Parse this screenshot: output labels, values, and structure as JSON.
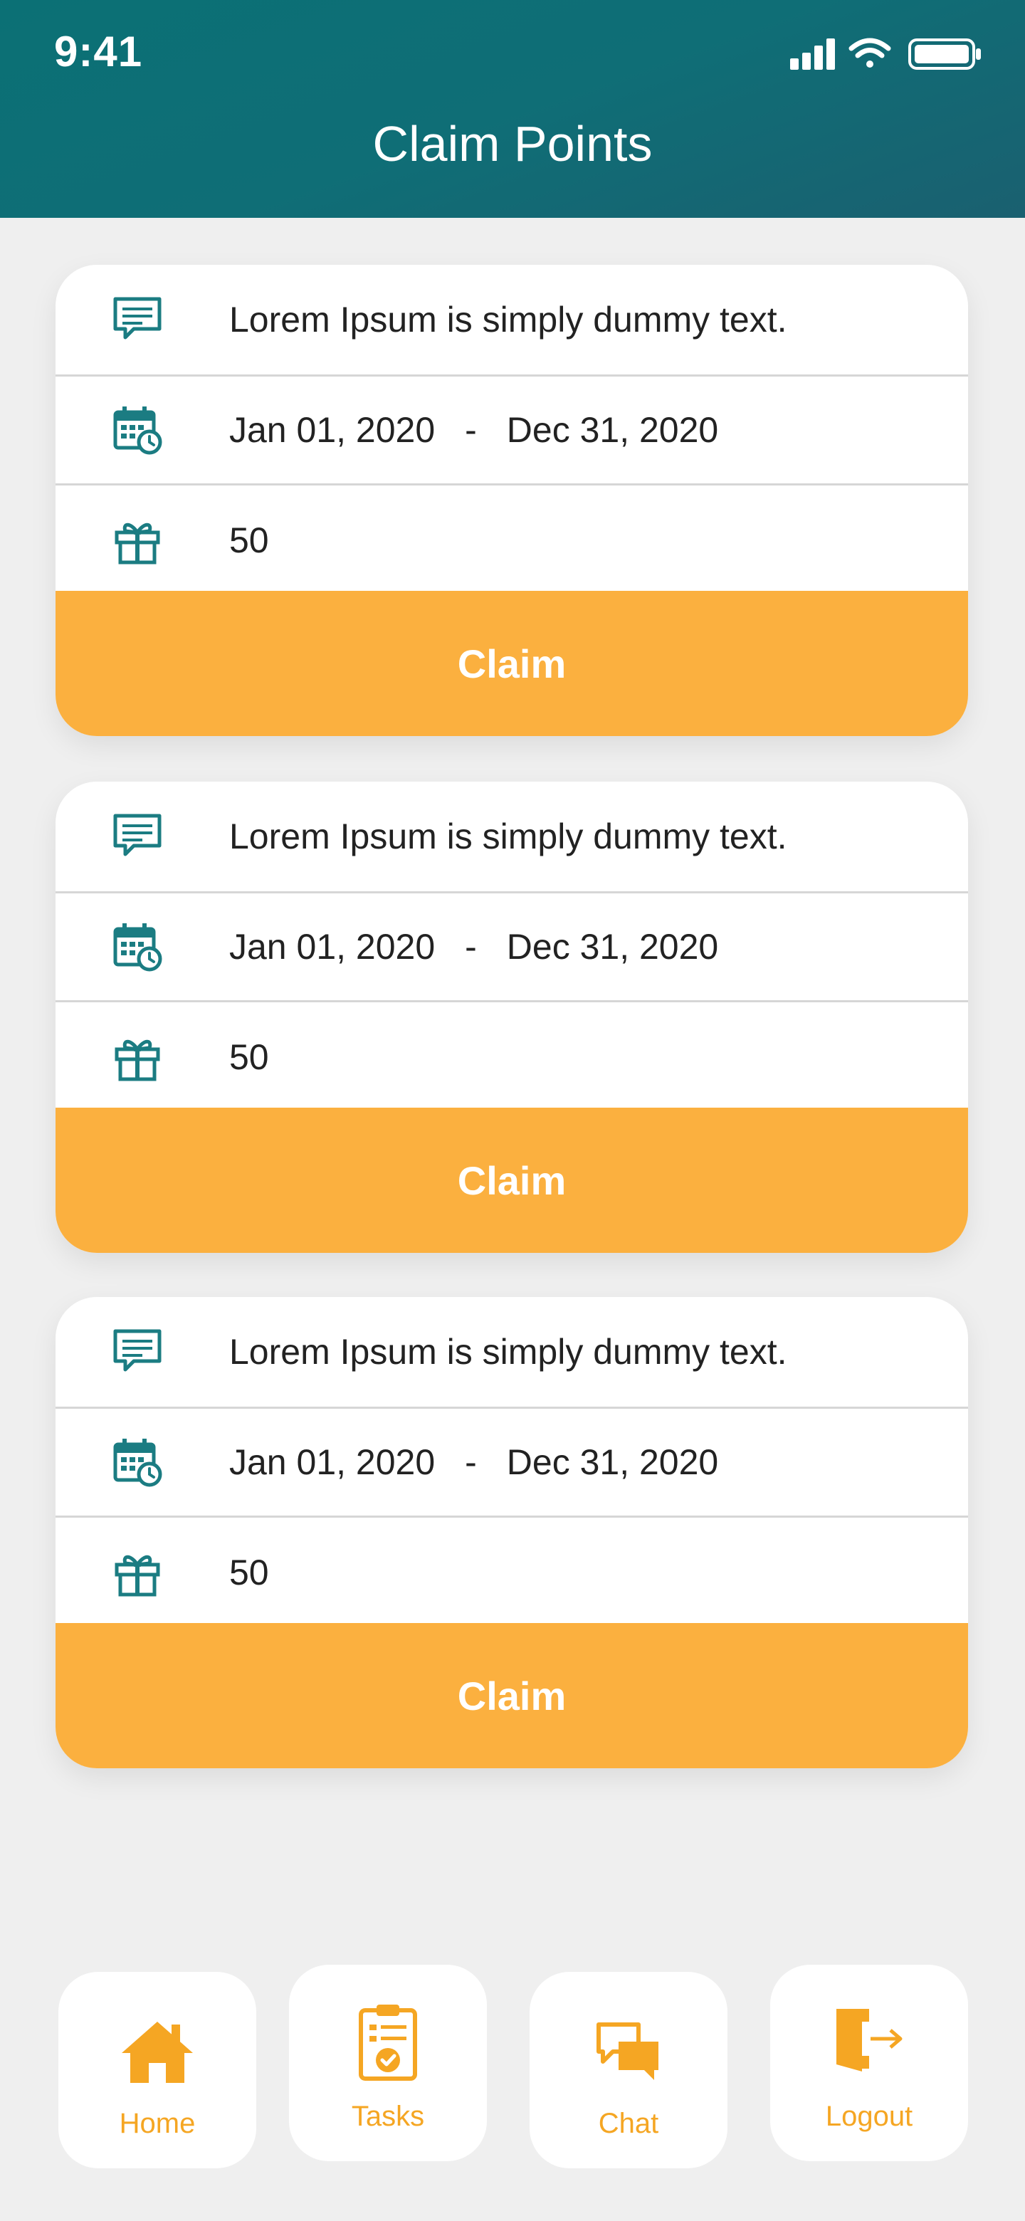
{
  "status_bar": {
    "time": "9:41"
  },
  "header": {
    "title": "Claim Points"
  },
  "cards": [
    {
      "message": "Lorem Ipsum is simply dummy text.",
      "start_date": "Jan 01, 2020",
      "separator": "-",
      "end_date": "Dec 31, 2020",
      "points": "50",
      "claim_label": "Claim"
    },
    {
      "message": "Lorem Ipsum is simply dummy text.",
      "start_date": "Jan 01, 2020",
      "separator": "-",
      "end_date": "Dec 31, 2020",
      "points": "50",
      "claim_label": "Claim"
    },
    {
      "message": "Lorem Ipsum is simply dummy text.",
      "start_date": "Jan 01, 2020",
      "separator": "-",
      "end_date": "Dec 31, 2020",
      "points": "50",
      "claim_label": "Claim"
    }
  ],
  "bottom_nav": [
    {
      "label": "Home",
      "icon": "home-icon"
    },
    {
      "label": "Tasks",
      "icon": "clipboard-check-icon"
    },
    {
      "label": "Chat",
      "icon": "chat-bubbles-icon"
    },
    {
      "label": "Logout",
      "icon": "logout-door-icon"
    }
  ],
  "colors": {
    "header": "#0f6e76",
    "accent": "#fbb03f",
    "icon_teal": "#1b7c82",
    "nav_icon": "#f5a623",
    "background": "#efefef"
  }
}
